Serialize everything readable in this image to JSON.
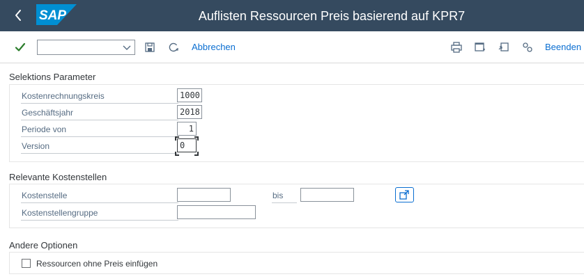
{
  "shell": {
    "title": "Auflisten Ressourcen Preis basierend auf KPR7",
    "logo_text": "SAP",
    "brand_color": "#008fd3",
    "header_color": "#354a5f"
  },
  "toolbar": {
    "command_field_value": "",
    "cancel_label": "Abbrechen",
    "exit_label": "Beenden",
    "icons": [
      "check-icon",
      "chevron-down-icon",
      "save-icon",
      "back-history-icon",
      "print-icon",
      "new-window-icon",
      "generate-shortcut-icon",
      "settings-icon"
    ]
  },
  "selektion": {
    "title": "Selektions Parameter",
    "fields": [
      {
        "label": "Kostenrechnungskreis",
        "value": "1000"
      },
      {
        "label": "Geschäftsjahr",
        "value": "2018"
      },
      {
        "label": "Periode von",
        "value": "1"
      },
      {
        "label": "Version",
        "value": "0"
      }
    ]
  },
  "kostenstellen": {
    "title": "Relevante Kostenstellen",
    "kostenstelle_label": "Kostenstelle",
    "kostenstelle_from": "",
    "bis_label": "bis",
    "kostenstelle_to": "",
    "gruppe_label": "Kostenstellengruppe",
    "gruppe_value": ""
  },
  "optionen": {
    "title": "Andere Optionen",
    "checkbox_label": "Ressourcen ohne Preis einfügen",
    "checkbox_checked": false
  }
}
